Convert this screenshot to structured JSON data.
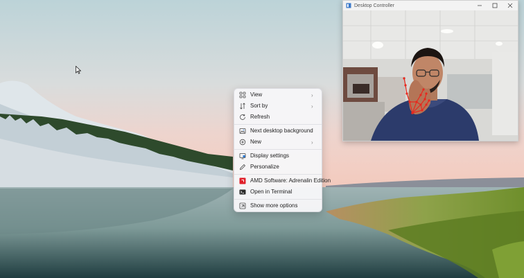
{
  "context_menu": {
    "items": [
      {
        "label": "View",
        "icon": "grid-icon",
        "submenu": true
      },
      {
        "label": "Sort by",
        "icon": "sort-icon",
        "submenu": true
      },
      {
        "label": "Refresh",
        "icon": "refresh-icon",
        "submenu": false
      },
      {
        "label": "Next desktop background",
        "icon": "background-icon",
        "submenu": false
      },
      {
        "label": "New",
        "icon": "new-icon",
        "submenu": true
      },
      {
        "label": "Display settings",
        "icon": "display-icon",
        "submenu": false
      },
      {
        "label": "Personalize",
        "icon": "pen-icon",
        "submenu": false
      },
      {
        "label": "AMD Software: Adrenalin Edition",
        "icon": "amd-icon",
        "submenu": false
      },
      {
        "label": "Open in Terminal",
        "icon": "terminal-icon",
        "submenu": false
      },
      {
        "label": "Show more options",
        "icon": "more-options-icon",
        "submenu": false
      }
    ]
  },
  "camera_window": {
    "title": "Desktop Controller",
    "controls": [
      "minimize",
      "maximize",
      "close"
    ]
  },
  "colors": {
    "amd_red": "#e0202a",
    "landmark_red": "#e8281e",
    "menu_bg": "#f6f6f8"
  }
}
